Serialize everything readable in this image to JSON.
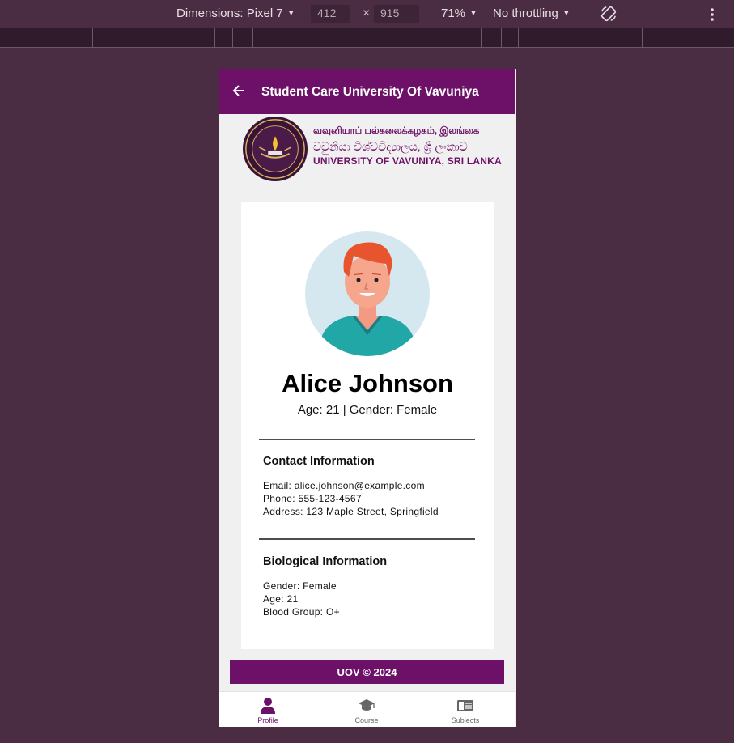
{
  "devtools": {
    "device_label": "Dimensions: Pixel 7",
    "width": "412",
    "height": "915",
    "times": "×",
    "zoom": "71%",
    "throttle": "No throttling",
    "icons": [
      "caret-down-icon",
      "rotate-icon",
      "more-vertical-icon"
    ]
  },
  "appbar": {
    "title": "Student Care University Of Vavuniya",
    "back_icon": "arrow-left-icon"
  },
  "university": {
    "name_tamil": "வவுனியாப் பல்கலைக்கழகம், இலங்கை",
    "name_sinhala": "වවුනියා විශ්වවිද්‍යාලය, ශ්‍රී ලංකාව",
    "name_english": "UNIVERSITY OF VAVUNIYA, SRI LANKA"
  },
  "profile": {
    "name": "Alice Johnson",
    "summary": "Age: 21 | Gender: Female",
    "contact": {
      "title": "Contact Information",
      "email": "Email: alice.johnson@example.com",
      "phone": "Phone: 555-123-4567",
      "address": "Address: 123 Maple Street, Springfield"
    },
    "bio": {
      "title": "Biological Information",
      "gender": "Gender: Female",
      "age": "Age: 21",
      "blood": "Blood Group: O+"
    }
  },
  "footer": {
    "text": "UOV © 2024"
  },
  "nav": {
    "items": [
      {
        "label": "Profile",
        "icon": "person-icon",
        "active": true
      },
      {
        "label": "Course",
        "icon": "graduation-cap-icon",
        "active": false
      },
      {
        "label": "Subjects",
        "icon": "book-icon",
        "active": false
      }
    ]
  },
  "colors": {
    "brand": "#6c1167",
    "devtools_bg": "#4b2d43",
    "page_bg": "#f1f0f0"
  }
}
